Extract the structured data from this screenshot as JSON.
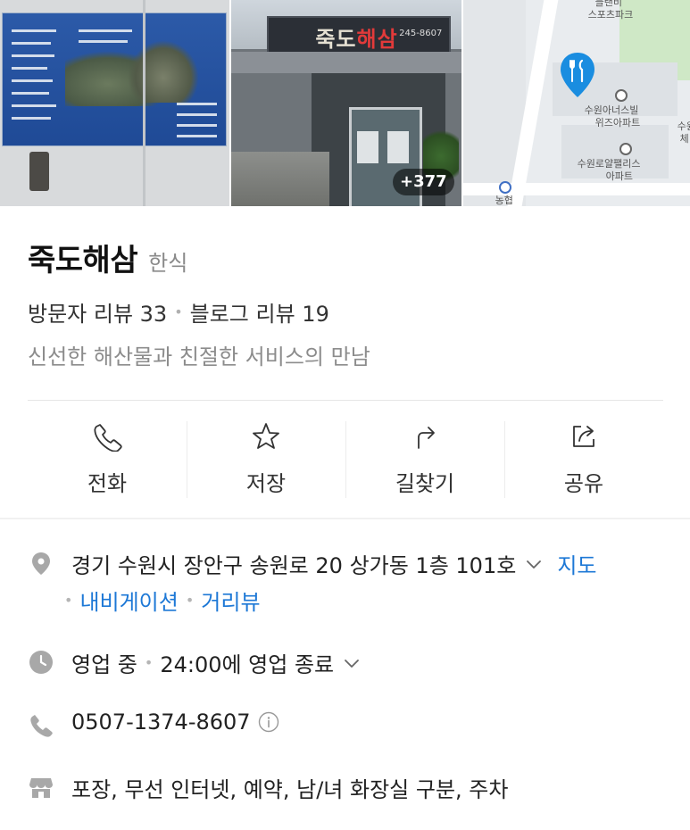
{
  "photos": {
    "photo_count_badge": "+377",
    "storefront_sign_name_black": "죽도",
    "storefront_sign_name_red": "해삼",
    "storefront_sign_phone": "245-8607",
    "map_labels": [
      "블랜비",
      "스포츠파크",
      "수원아너스빌",
      "위즈아파트",
      "수원로얄팰리스",
      "아파트",
      "수원",
      "체",
      "농협"
    ]
  },
  "place": {
    "name": "죽도해삼",
    "category": "한식",
    "visitor_reviews": "방문자 리뷰 33",
    "blog_reviews": "블로그 리뷰 19",
    "description": "신선한 해산물과 친절한 서비스의 만남"
  },
  "actions": [
    {
      "label": "전화",
      "icon": "phone-icon"
    },
    {
      "label": "저장",
      "icon": "star-icon"
    },
    {
      "label": "길찾기",
      "icon": "directions-icon"
    },
    {
      "label": "공유",
      "icon": "share-icon"
    }
  ],
  "info": {
    "address": "경기 수원시 장안구 송원로 20 상가동 1층 101호",
    "map_link": "지도",
    "navigation_link": "내비게이션",
    "streetview_link": "거리뷰",
    "status": "영업 중",
    "hours": "24:00에 영업 종료",
    "phone": "0507-1374-8607",
    "amenities": "포장, 무선 인터넷, 예약, 남/녀 화장실 구분, 주차"
  },
  "colors": {
    "link": "#1d78d6",
    "pin": "#1a8de0",
    "icon_gray": "#a8a8a8",
    "muted_text": "#8c8c8c"
  }
}
